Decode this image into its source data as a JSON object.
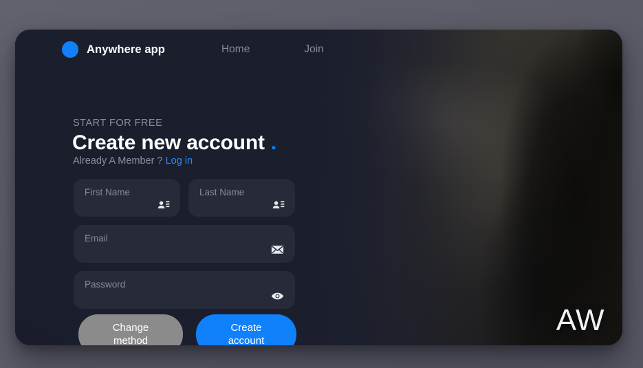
{
  "page": {
    "background_color": "#5d5d69"
  },
  "card": {
    "background_color": "#1b1e2d",
    "accent_color": "#1180fb"
  },
  "topbar": {
    "brand": {
      "logo_icon": "blue-circle-icon",
      "name": "Anywhere app"
    },
    "nav": [
      {
        "label": "Home"
      },
      {
        "label": "Join"
      }
    ]
  },
  "hero": {
    "eyebrow": "START FOR FREE",
    "headline": "Create new account",
    "headline_accent": ".",
    "member_prompt": "Already A Member ?",
    "login_label": "Log in"
  },
  "form": {
    "fields": [
      {
        "label": "First Name",
        "value": "",
        "icon": "contact-card-icon",
        "width": "half"
      },
      {
        "label": "Last Name",
        "value": "",
        "icon": "contact-card-icon",
        "width": "half"
      },
      {
        "label": "Email",
        "value": "",
        "icon": "envelope-icon",
        "width": "full"
      },
      {
        "label": "Password",
        "value": "",
        "icon": "eye-icon",
        "width": "full"
      }
    ]
  },
  "actions": {
    "secondary_line1": "Change",
    "secondary_line2": "method",
    "primary_line1": "Create",
    "primary_line2": "account"
  },
  "watermark": {
    "text": "AW"
  }
}
